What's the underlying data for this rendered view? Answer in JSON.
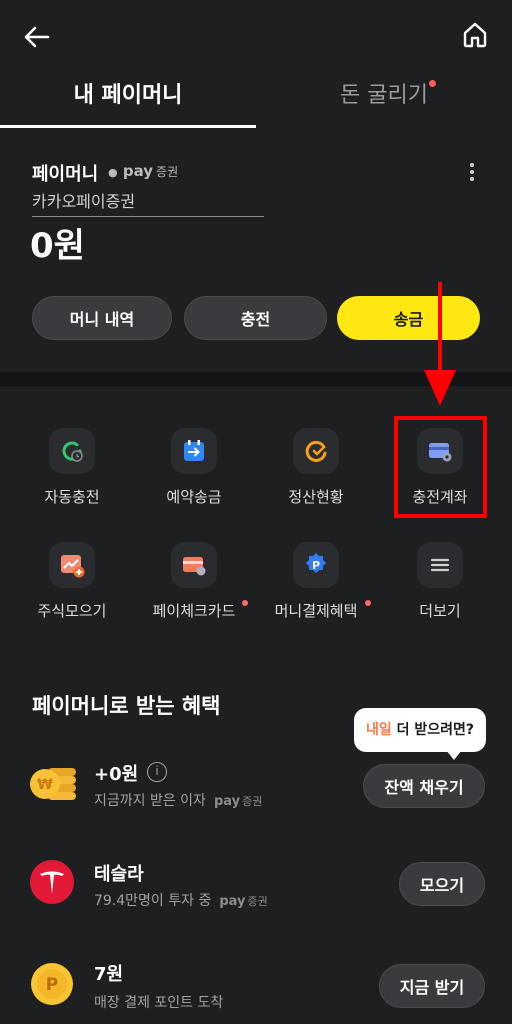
{
  "tabs": [
    {
      "label": "내 페이머니"
    },
    {
      "label": "돈 굴리기"
    }
  ],
  "card": {
    "title": "페이머니",
    "pay_logo": "pay",
    "pay_logo_sub": "증권",
    "account_name": "카카오페이증권",
    "balance": "0원",
    "buttons": {
      "history": "머니 내역",
      "charge": "충전",
      "send": "송금"
    }
  },
  "menu": [
    {
      "label": "자동충전",
      "icon": "auto-charge-icon"
    },
    {
      "label": "예약송금",
      "icon": "scheduled-transfer-icon"
    },
    {
      "label": "정산현황",
      "icon": "settlement-icon"
    },
    {
      "label": "충전계좌",
      "icon": "charge-account-icon"
    },
    {
      "label": "주식모으기",
      "icon": "stock-collect-icon"
    },
    {
      "label": "페이체크카드",
      "icon": "check-card-icon"
    },
    {
      "label": "머니결제혜택",
      "icon": "payment-benefit-icon"
    },
    {
      "label": "더보기",
      "icon": "menu-icon"
    }
  ],
  "benefits": {
    "title": "페이머니로 받는 혜택",
    "tooltip_highlight": "내일",
    "tooltip_rest": " 더 받으려면?",
    "rows": [
      {
        "title": "+0원",
        "sub": "지금까지 받은 이자",
        "pay": "pay",
        "pay_sub": "증권",
        "button": "잔액 채우기",
        "icon": "coin-stack-icon"
      },
      {
        "title": "테슬라",
        "sub": "79.4만명이 투자 중",
        "pay": "pay",
        "pay_sub": "증권",
        "button": "모으기",
        "icon": "tesla-logo-icon"
      },
      {
        "title": "7원",
        "sub": "매장 결제 포인트 도착",
        "button": "지금 받기",
        "icon": "point-coin-icon"
      }
    ]
  },
  "colors": {
    "background": "#1e1f21",
    "accent_yellow": "#ffe812",
    "highlight_red": "#ff0000",
    "notification_dot": "#ff6b6b"
  }
}
